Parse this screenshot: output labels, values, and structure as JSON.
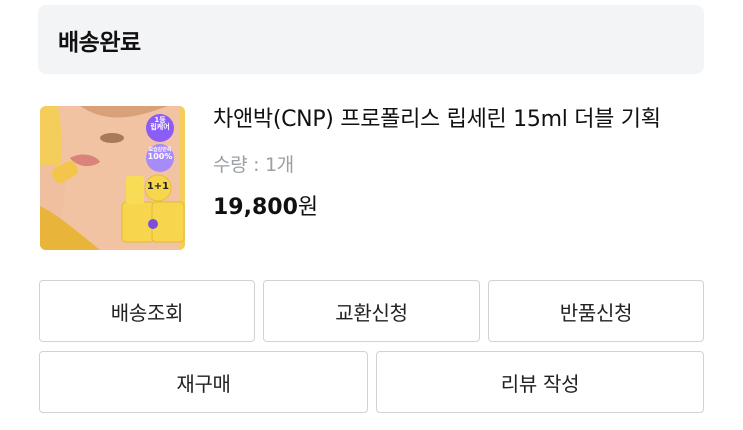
{
  "order_status": {
    "title": "배송완료"
  },
  "product": {
    "image_badges": {
      "rank": "1등",
      "rank_sub": "립케어",
      "pct_top": "보습감만족",
      "pct": "100%",
      "set": "1+1"
    },
    "name": "차앤박(CNP) 프로폴리스 립세린 15ml 더블 기획",
    "quantity": "수량 : 1개",
    "price_amount": "19,800",
    "price_unit": "원"
  },
  "actions": {
    "track": "배송조회",
    "exchange": "교환신청",
    "return": "반품신청",
    "rebuy": "재구매",
    "review": "리뷰 작성"
  },
  "colors": {
    "header_bg": "#f3f4f6",
    "button_border": "#cfd3d8",
    "quantity_text": "#9aa0a6"
  }
}
